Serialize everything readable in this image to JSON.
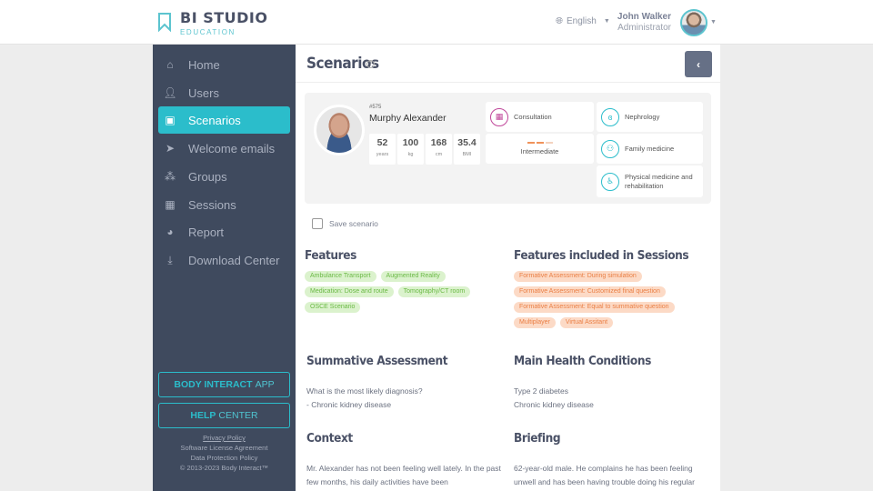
{
  "header": {
    "logo_title": "BI STUDIO",
    "logo_subtitle": "EDUCATION",
    "language": "English",
    "user_name": "John Walker",
    "user_role": "Administrator"
  },
  "sidebar": {
    "items": [
      {
        "label": "Home",
        "icon": "home-icon"
      },
      {
        "label": "Users",
        "icon": "user-icon"
      },
      {
        "label": "Scenarios",
        "icon": "id-card-icon",
        "active": true
      },
      {
        "label": "Welcome emails",
        "icon": "paper-plane-icon"
      },
      {
        "label": "Groups",
        "icon": "group-icon"
      },
      {
        "label": "Sessions",
        "icon": "calendar-icon"
      },
      {
        "label": "Report",
        "icon": "pie-chart-icon"
      },
      {
        "label": "Download Center",
        "icon": "download-icon"
      }
    ],
    "app_button_bold": "BODY INTERACT",
    "app_button_light": "APP",
    "help_button_bold": "HELP",
    "help_button_light": "CENTER",
    "footer": {
      "privacy": "Privacy Policy",
      "license": "Software License Agreement",
      "data_protection": "Data Protection Policy",
      "copyright": "© 2013-2023 Body Interact™"
    }
  },
  "page": {
    "title": "Scenarios",
    "help_glyph": "?",
    "back_glyph": "‹"
  },
  "patient": {
    "id": "#575",
    "name": "Murphy Alexander",
    "stats": [
      {
        "value": "52",
        "unit": "years"
      },
      {
        "value": "100",
        "unit": "kg"
      },
      {
        "value": "168",
        "unit": "cm"
      },
      {
        "value": "35.4",
        "unit": "BMI"
      }
    ],
    "type": "Consultation",
    "level": "Intermediate",
    "level_value": 2,
    "level_max": 3,
    "specialties": [
      "Nephrology",
      "Family medicine",
      "Physical medicine and rehabilitation"
    ]
  },
  "save_scenario_label": "Save scenario",
  "features": {
    "title": "Features",
    "tags": [
      "Ambulance Transport",
      "Augmented Reality",
      "Medication: Dose and route",
      "Tomography/CT room",
      "OSCE Scenario"
    ]
  },
  "session_features": {
    "title": "Features included in Sessions",
    "tags": [
      "Formative Assessment: During simulation",
      "Formative Assessment: Customized final question",
      "Formative Assessment: Equal to summative question",
      "Multiplayer",
      "Virtual Assitant"
    ]
  },
  "summative": {
    "title": "Summative Assessment",
    "lines": [
      "What is the most likely diagnosis?",
      "- Chronic kidney disease"
    ]
  },
  "conditions": {
    "title": "Main Health Conditions",
    "lines": [
      "Type 2 diabetes",
      "Chronic kidney disease"
    ]
  },
  "context": {
    "title": "Context",
    "text": "Mr. Alexander has not been feeling well lately. In the past few months, his daily activities have been"
  },
  "briefing": {
    "title": "Briefing",
    "text": "62-year-old male. He complains he has been feeling unwell and has been having trouble doing his regular"
  },
  "colors": {
    "accent": "#2bbdcb",
    "sidebar_bg": "#3f4a5e",
    "feature_tag_bg": "#dbf2cd",
    "session_tag_bg": "#fcdac6"
  }
}
